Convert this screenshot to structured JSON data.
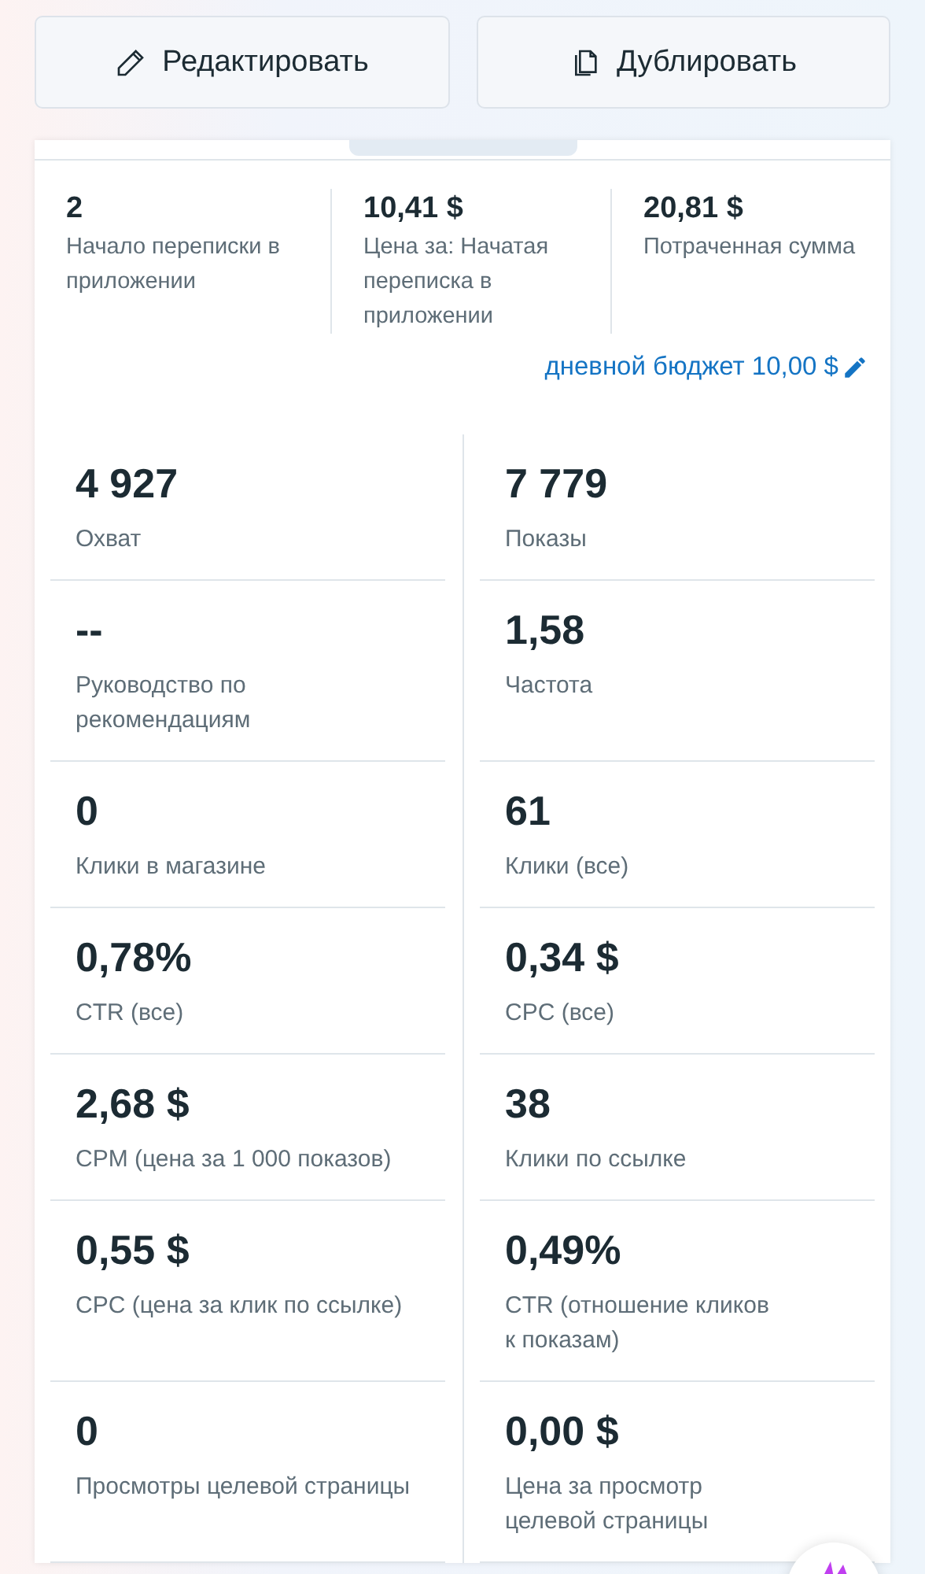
{
  "actions": [
    {
      "kind": "edit",
      "label": "Редактировать"
    },
    {
      "kind": "duplicate",
      "label": "Дублировать"
    }
  ],
  "summary": [
    {
      "value": "2",
      "label": "Начало переписки в приложении"
    },
    {
      "value": "10,41 $",
      "label": "Цена за: Начатая переписка в приложении"
    },
    {
      "value": "20,81 $",
      "label": "Потраченная сумма"
    }
  ],
  "budget_link": "дневной бюджет 10,00 $",
  "metrics_left": [
    {
      "value": "4 927",
      "label": "Охват"
    },
    {
      "value": "--",
      "label": "Руководство по рекомендациям"
    },
    {
      "value": "0",
      "label": "Клики в магазине"
    },
    {
      "value": "0,78%",
      "label": "CTR (все)"
    },
    {
      "value": "2,68 $",
      "label": "CPM (цена за 1 000 показов)"
    },
    {
      "value": "0,55 $",
      "label": "CPC (цена за клик по ссылке)"
    },
    {
      "value": "0",
      "label": "Просмотры целевой страницы"
    }
  ],
  "metrics_right": [
    {
      "value": "7 779",
      "label": "Показы"
    },
    {
      "value": "1,58",
      "label": "Частота"
    },
    {
      "value": "61",
      "label": "Клики (все)"
    },
    {
      "value": "0,34 $",
      "label": "CPC (все)"
    },
    {
      "value": "38",
      "label": "Клики по ссылке"
    },
    {
      "value": "0,49%",
      "label": "CTR (отношение кликов к показам)"
    },
    {
      "value": "0,00 $",
      "label": "Цена за просмотр целевой страницы"
    }
  ]
}
